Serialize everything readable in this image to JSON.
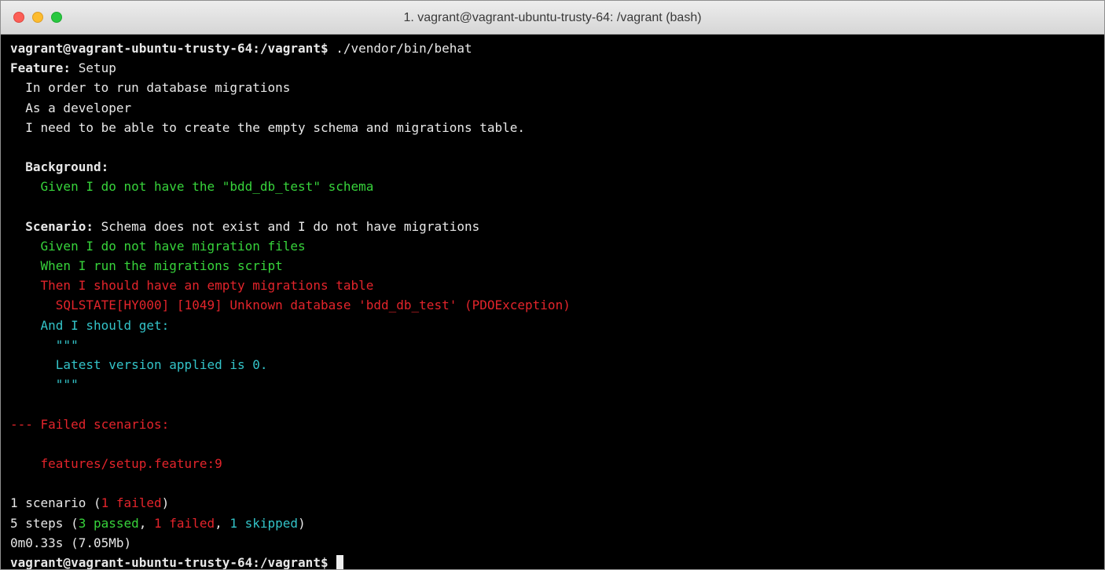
{
  "window": {
    "title": "1. vagrant@vagrant-ubuntu-trusty-64: /vagrant (bash)"
  },
  "colors": {
    "passed": "#37d33b",
    "failed": "#e3242b",
    "skipped": "#33c3c8",
    "text": "#e8e8e8",
    "background": "#000000"
  },
  "terminal": {
    "prompt": "vagrant@vagrant-ubuntu-trusty-64:/vagrant$",
    "command": " ./vendor/bin/behat",
    "feature_keyword": "Feature:",
    "feature_name": " Setup",
    "narrative": [
      "  In order to run database migrations",
      "  As a developer",
      "  I need to be able to create the empty schema and migrations table."
    ],
    "background_keyword": "  Background:",
    "background_step": "    Given I do not have the \"bdd_db_test\" schema",
    "scenario_keyword": "  Scenario:",
    "scenario_name": " Schema does not exist and I do not have migrations",
    "steps": {
      "given": "    Given I do not have migration files",
      "when": "    When I run the migrations script",
      "then": "    Then I should have an empty migrations table",
      "exception": "      SQLSTATE[HY000] [1049] Unknown database 'bdd_db_test' (PDOException)",
      "and": "    And I should get:",
      "docstring_open": "      \"\"\"",
      "docstring_body": "      Latest version applied is 0.",
      "docstring_close": "      \"\"\""
    },
    "failed_header": "--- Failed scenarios:",
    "failed_item": "    features/setup.feature:9",
    "summary": {
      "scenarios_prefix": "1 scenario (",
      "scenarios_failed": "1 failed",
      "scenarios_suffix": ")",
      "steps_prefix": "5 steps (",
      "steps_passed": "3 passed",
      "sep1": ", ",
      "steps_failed": "1 failed",
      "sep2": ", ",
      "steps_skipped": "1 skipped",
      "steps_suffix": ")",
      "timing": "0m0.33s (7.05Mb)"
    },
    "final_prompt": "vagrant@vagrant-ubuntu-trusty-64:/vagrant$ "
  }
}
